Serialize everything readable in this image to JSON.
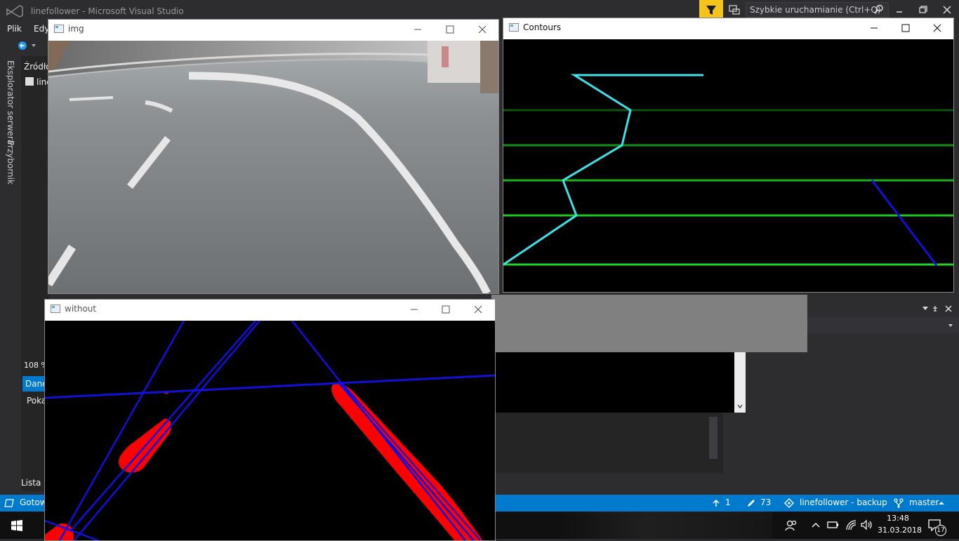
{
  "vs": {
    "title": "linefollower - Microsoft Visual Studio",
    "quick_launch_placeholder": "Szybkie uruchamianie (Ctrl+Q)",
    "menu": [
      "Plik",
      "Edy"
    ],
    "side_tabs": [
      "Eksplorator serwera",
      "Przybornik"
    ],
    "solution_heading": "Źródło",
    "solution_item": "line",
    "zoom": "108 %",
    "data_tab": "Dane",
    "show_label": "Poka",
    "error_list": "Lista b"
  },
  "status_bar": {
    "ready": "Gotow",
    "pushes": "1",
    "changes": "73",
    "repo": "linefollower - backup",
    "branch": "master"
  },
  "taskbar": {
    "time": "13:48",
    "date": "31.03.2018",
    "notifications": "17"
  },
  "windows": {
    "img": {
      "title": "img"
    },
    "contours": {
      "title": "Contours"
    },
    "without": {
      "title": "without"
    }
  },
  "colors": {
    "vs_blue": "#007acc",
    "filter_yellow": "#f6c21c",
    "contour_cyan": "#40e0e8",
    "detected_blue": "#1010d8",
    "mask_red": "#ff0000",
    "guide_green": "#22cc22"
  }
}
